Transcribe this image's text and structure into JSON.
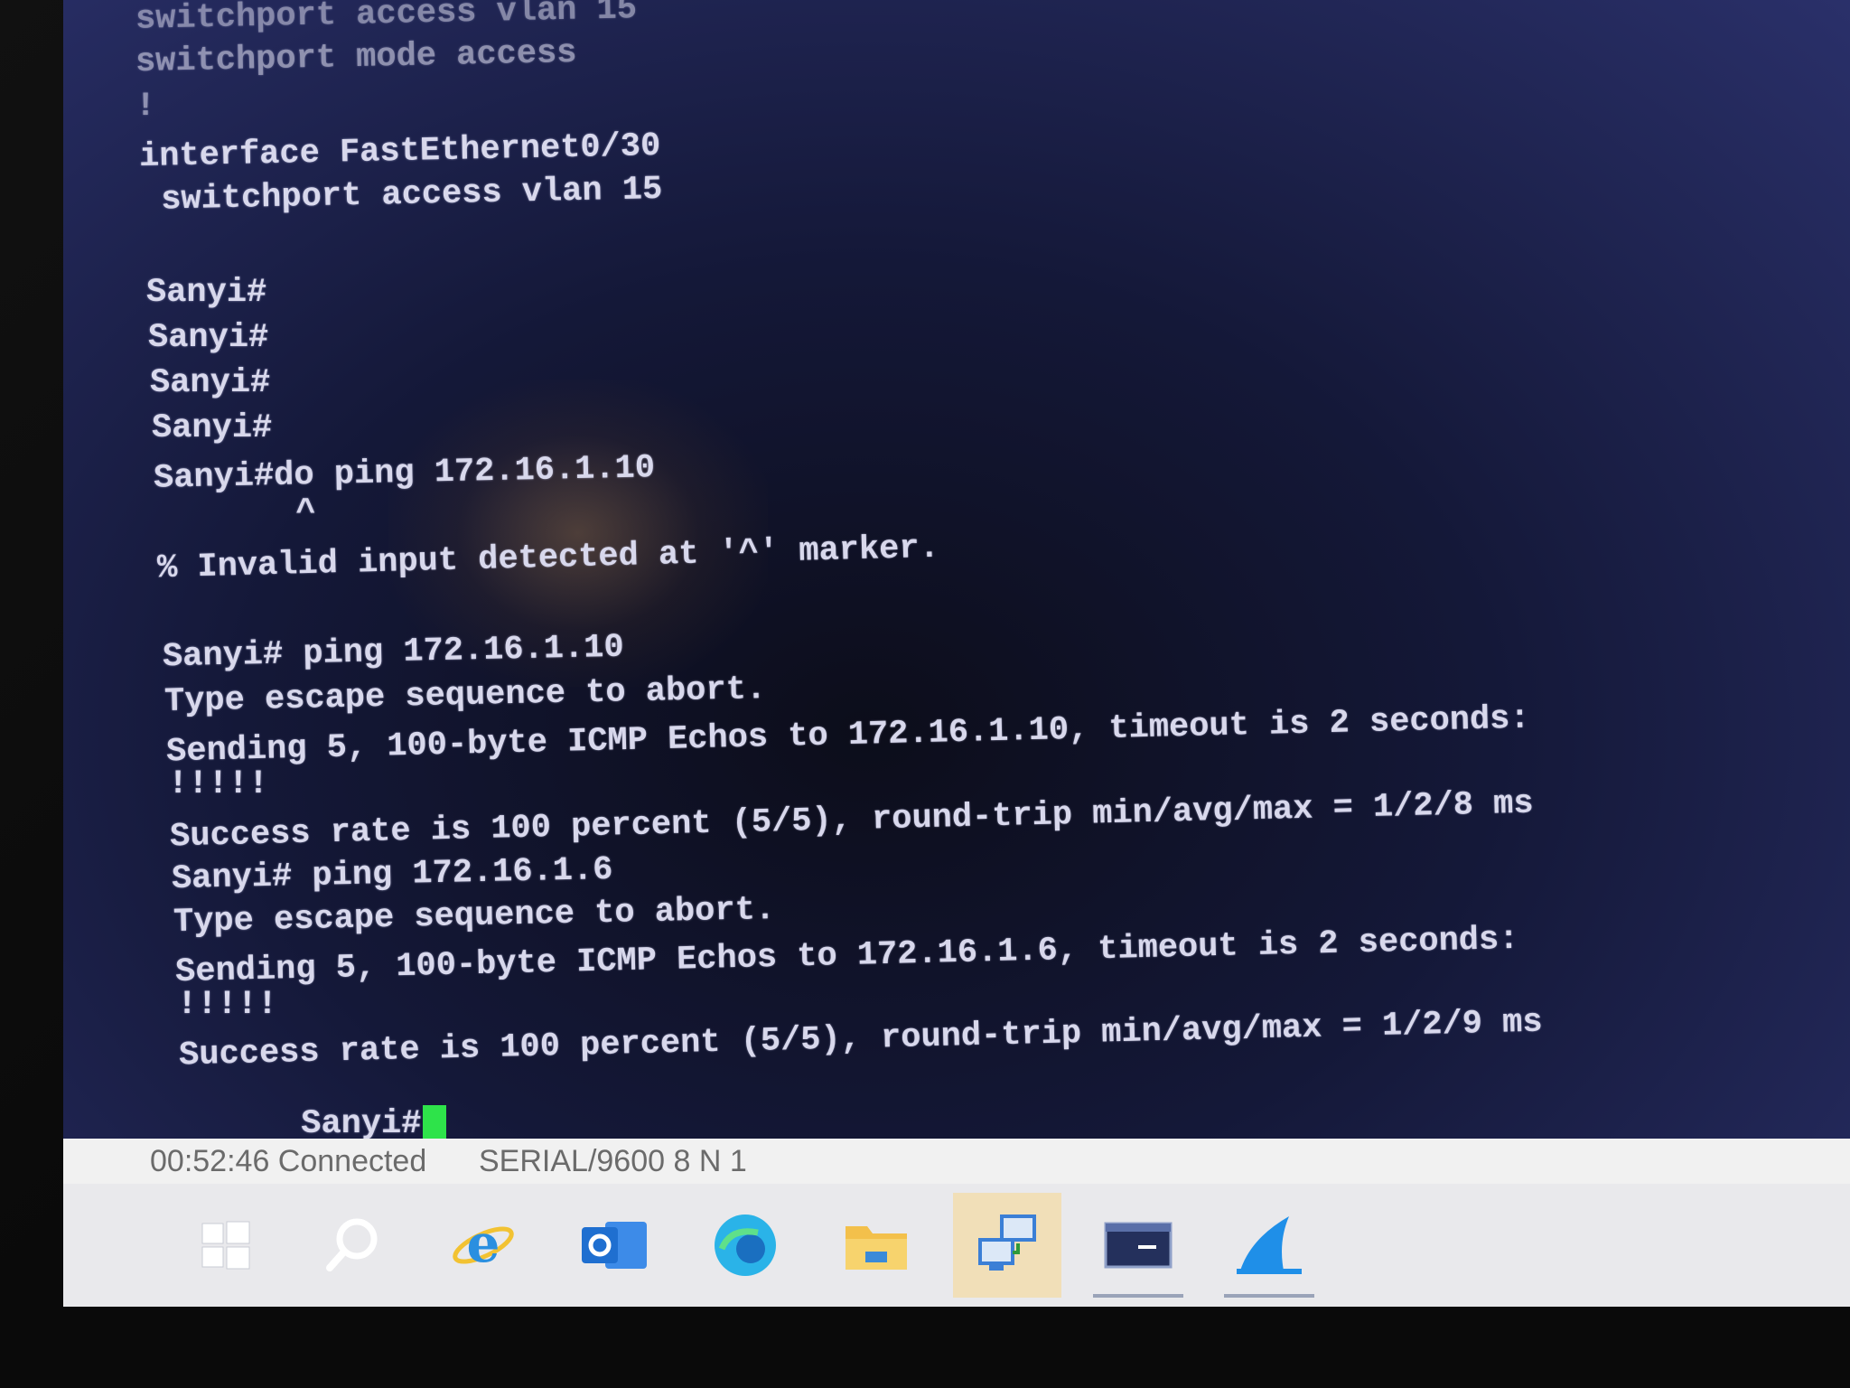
{
  "terminal": {
    "lines": [
      "switchport access vlan 15",
      "switchport mode access",
      "!",
      "interface FastEthernet0/30",
      " switchport access vlan 15",
      "",
      "Sanyi#",
      "Sanyi#",
      "Sanyi#",
      "Sanyi#",
      "Sanyi#do ping 172.16.1.10",
      "       ^",
      "% Invalid input detected at '^' marker.",
      "",
      "Sanyi# ping 172.16.1.10",
      "Type escape sequence to abort.",
      "Sending 5, 100-byte ICMP Echos to 172.16.1.10, timeout is 2 seconds:",
      "!!!!!",
      "Success rate is 100 percent (5/5), round-trip min/avg/max = 1/2/8 ms",
      "Sanyi# ping 172.16.1.6",
      "Type escape sequence to abort.",
      "Sending 5, 100-byte ICMP Echos to 172.16.1.6, timeout is 2 seconds:",
      "!!!!!",
      "Success rate is 100 percent (5/5), round-trip min/avg/max = 1/2/9 ms"
    ],
    "prompt": "Sanyi#"
  },
  "status_bar": {
    "connection": "00:52:46 Connected",
    "serial": "SERIAL/9600 8 N 1"
  },
  "taskbar": {
    "items": [
      {
        "name": "start-button",
        "icon": "windows-logo-icon",
        "color": "#ffffff"
      },
      {
        "name": "search-button",
        "icon": "search-icon",
        "color": "#ffffff"
      },
      {
        "name": "internet-explorer-button",
        "icon": "internet-explorer-icon",
        "color": "#2a8fe0"
      },
      {
        "name": "outlook-button",
        "icon": "outlook-icon",
        "color": "#1f6fd0"
      },
      {
        "name": "edge-button",
        "icon": "edge-icon",
        "color": "#2ab3e8"
      },
      {
        "name": "file-explorer-button",
        "icon": "folder-icon",
        "color": "#f3c04b"
      },
      {
        "name": "network-app-button",
        "icon": "network-computers-icon",
        "color": "#3b7fd6"
      },
      {
        "name": "terminal-app-button",
        "icon": "terminal-window-icon",
        "color": "#24305c"
      },
      {
        "name": "wireshark-button",
        "icon": "shark-fin-icon",
        "color": "#1f8fe8"
      }
    ]
  }
}
